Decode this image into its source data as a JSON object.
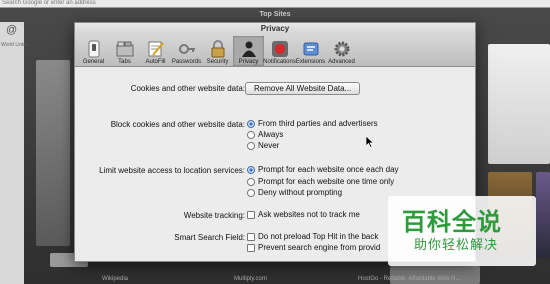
{
  "background": {
    "address_text": "Search Google or enter an address",
    "title": "Top Sites",
    "left_label": "World Links",
    "captions": [
      "Wikipedia",
      "Multiply.com",
      "HostGo - Reliable, Affordable Web H..."
    ]
  },
  "window": {
    "title": "Privacy",
    "toolbar": [
      {
        "label": "General",
        "icon": "general-switch-icon"
      },
      {
        "label": "Tabs",
        "icon": "tabs-icon"
      },
      {
        "label": "AutoFill",
        "icon": "autofill-pencil-icon"
      },
      {
        "label": "Passwords",
        "icon": "passwords-key-icon"
      },
      {
        "label": "Security",
        "icon": "security-lock-icon"
      },
      {
        "label": "Privacy",
        "icon": "privacy-silhouette-icon"
      },
      {
        "label": "Notifications",
        "icon": "notifications-icon"
      },
      {
        "label": "Extensions",
        "icon": "extensions-icon"
      },
      {
        "label": "Advanced",
        "icon": "advanced-gear-icon"
      }
    ],
    "active_tab": "Privacy"
  },
  "privacy": {
    "cookies_label": "Cookies and other website data:",
    "remove_button": "Remove All Website Data...",
    "block_label": "Block cookies and other website data:",
    "block_options": [
      "From third parties and advertisers",
      "Always",
      "Never"
    ],
    "block_selected": 0,
    "location_label": "Limit website access to location services:",
    "location_options": [
      "Prompt for each website once each day",
      "Prompt for each website one time only",
      "Deny without prompting"
    ],
    "location_selected": 0,
    "tracking_label": "Website tracking:",
    "tracking_option": "Ask websites not to track me",
    "smart_label": "Smart Search Field:",
    "smart_options": [
      "Do not preload Top Hit in the back",
      "Prevent search engine from provid"
    ]
  },
  "watermark": {
    "main": "百科全说",
    "sub": "助你轻松解决"
  },
  "colors": {
    "accent": "#2e6fd8",
    "watermark": "#2e9a3c"
  }
}
